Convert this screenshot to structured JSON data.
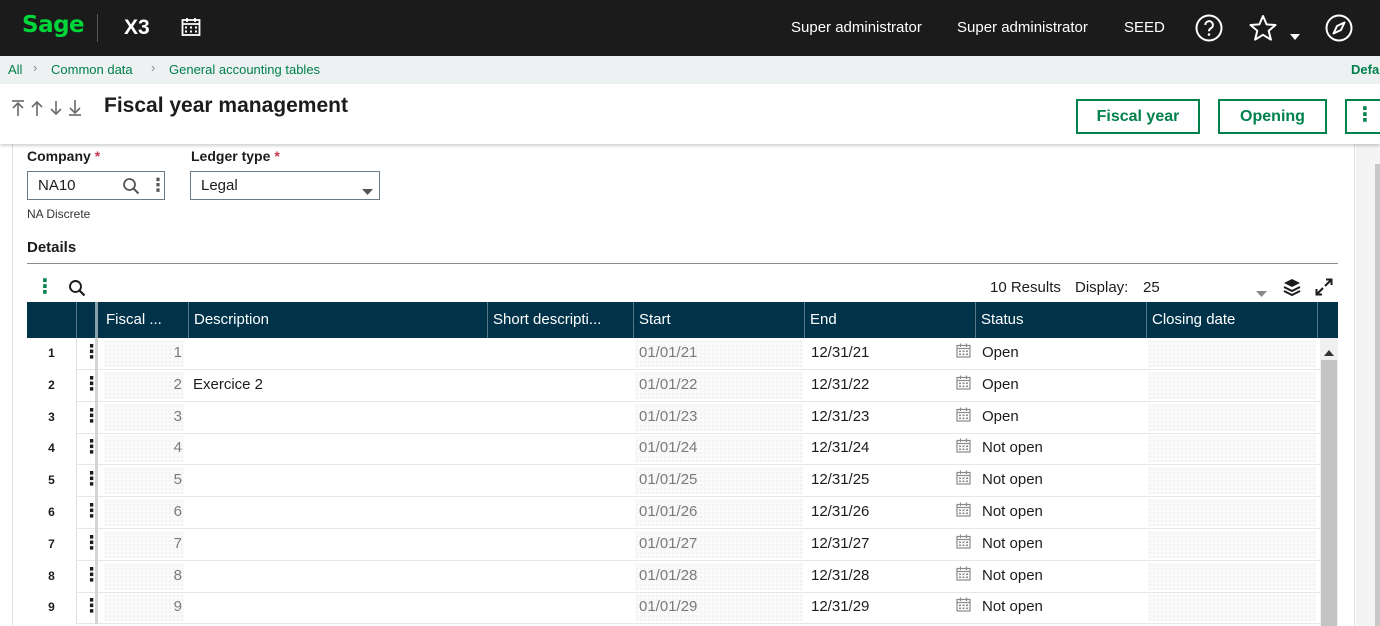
{
  "topbar": {
    "logo": "Sage",
    "product": "X3",
    "user1": "Super administrator",
    "user2": "Super administrator",
    "folder": "SEED"
  },
  "breadcrumb": {
    "items": [
      "All",
      "Common data",
      "General accounting tables"
    ],
    "right": "Defa"
  },
  "header": {
    "title": "Fiscal year management",
    "buttons": [
      "Fiscal year",
      "Opening"
    ]
  },
  "form": {
    "company_label": "Company",
    "company_value": "NA10",
    "company_desc": "NA Discrete",
    "ledger_label": "Ledger type",
    "ledger_value": "Legal",
    "required_mark": "*"
  },
  "details": {
    "section_title": "Details",
    "results": "10 Results",
    "display_label": "Display:",
    "display_value": "25",
    "columns": [
      "Fiscal ...",
      "Description",
      "Short descripti...",
      "Start",
      "End",
      "Status",
      "Closing date"
    ],
    "rows": [
      {
        "n": "1",
        "fiscal": "1",
        "desc": "",
        "short": "",
        "start": "01/01/21",
        "end": "12/31/21",
        "status": "Open",
        "closing": ""
      },
      {
        "n": "2",
        "fiscal": "2",
        "desc": "Exercice 2",
        "short": "",
        "start": "01/01/22",
        "end": "12/31/22",
        "status": "Open",
        "closing": ""
      },
      {
        "n": "3",
        "fiscal": "3",
        "desc": "",
        "short": "",
        "start": "01/01/23",
        "end": "12/31/23",
        "status": "Open",
        "closing": ""
      },
      {
        "n": "4",
        "fiscal": "4",
        "desc": "",
        "short": "",
        "start": "01/01/24",
        "end": "12/31/24",
        "status": "Not open",
        "closing": ""
      },
      {
        "n": "5",
        "fiscal": "5",
        "desc": "",
        "short": "",
        "start": "01/01/25",
        "end": "12/31/25",
        "status": "Not open",
        "closing": ""
      },
      {
        "n": "6",
        "fiscal": "6",
        "desc": "",
        "short": "",
        "start": "01/01/26",
        "end": "12/31/26",
        "status": "Not open",
        "closing": ""
      },
      {
        "n": "7",
        "fiscal": "7",
        "desc": "",
        "short": "",
        "start": "01/01/27",
        "end": "12/31/27",
        "status": "Not open",
        "closing": ""
      },
      {
        "n": "8",
        "fiscal": "8",
        "desc": "",
        "short": "",
        "start": "01/01/28",
        "end": "12/31/28",
        "status": "Not open",
        "closing": ""
      },
      {
        "n": "9",
        "fiscal": "9",
        "desc": "",
        "short": "",
        "start": "01/01/29",
        "end": "12/31/29",
        "status": "Not open",
        "closing": ""
      }
    ]
  },
  "colors": {
    "brand_green": "#00d639",
    "accent_green": "#00804a",
    "grid_header": "#003349",
    "topbar": "#1b1b1b"
  }
}
